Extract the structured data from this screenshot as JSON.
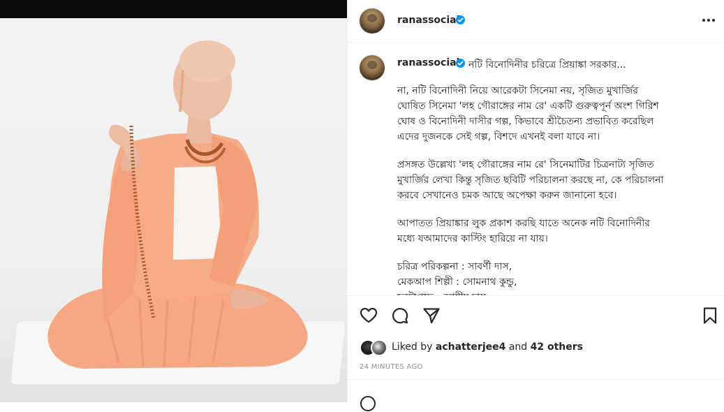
{
  "post": {
    "username": "ranassocial",
    "more_label": "More options",
    "caption_title": "নটি বিনোদিনীর চরিত্রে প্রিয়াঙ্কা সরকার...",
    "paragraphs": [
      "না, নটি বিনোদিনী নিয়ে আরেকটা সিনেমা নয়, সৃজিত মুখার্জির\nঘোষিত সিনেমা 'লহ গৌরাঙ্গের নাম রে' একটি গুরুত্বপূর্ন অংশ গিরিশ\nঘোষ ও বিনোদিনী দাসীর গল্প, কিভাবে শ্রীচৈতন্য প্রভাবিত করেছিল\nএদের দুজনকে সেই গল্প, বিশদে এখনই বলা যাবে না।",
      "প্রসঙ্গত উল্লেখ্য 'লহ গৌরাঙ্গের নাম রে' সিনেমাটির চিত্রনাট্য সৃজিত\nমুখার্জির লেখা কিন্তু সৃজিত ছবিটি পরিচালনা করছে না, কে পরিচালনা\nকরবে সেখানেও চমক আছে অপেক্ষা করুন জানানো হবে।",
      "আপাতত প্রিয়াঙ্কার লুক প্রকাশ করছি যাতে অনেক নটি বিনোদিনীর\nমধ্যে যআমাদের কাস্টিং হারিয়ে না যায়।"
    ],
    "credits": [
      "চরিত্র পরিকল্পনা : সাবর্ণী দাস,",
      "মেকআপ শিল্পী : সোমনাথ কুন্ডু,",
      "ফটোগ্রাফ : আশীষ দাস"
    ],
    "liked_by_prefix": "Liked by",
    "liked_by_user": "achatterjee4",
    "liked_by_and": "and",
    "liked_by_others": "42 others",
    "timestamp": "24 MINUTES AGO"
  },
  "icons": {
    "verified": "verified-badge-icon",
    "more": "more-dots-icon",
    "like": "heart-icon",
    "comment": "comment-bubble-icon",
    "share": "paper-plane-icon",
    "save": "bookmark-icon",
    "emoji": "emoji-smiley-icon"
  },
  "colors": {
    "verified_blue": "#0095f6",
    "text": "#262626",
    "muted": "#8e8e8e",
    "robe_orange": "#f4a27e"
  }
}
